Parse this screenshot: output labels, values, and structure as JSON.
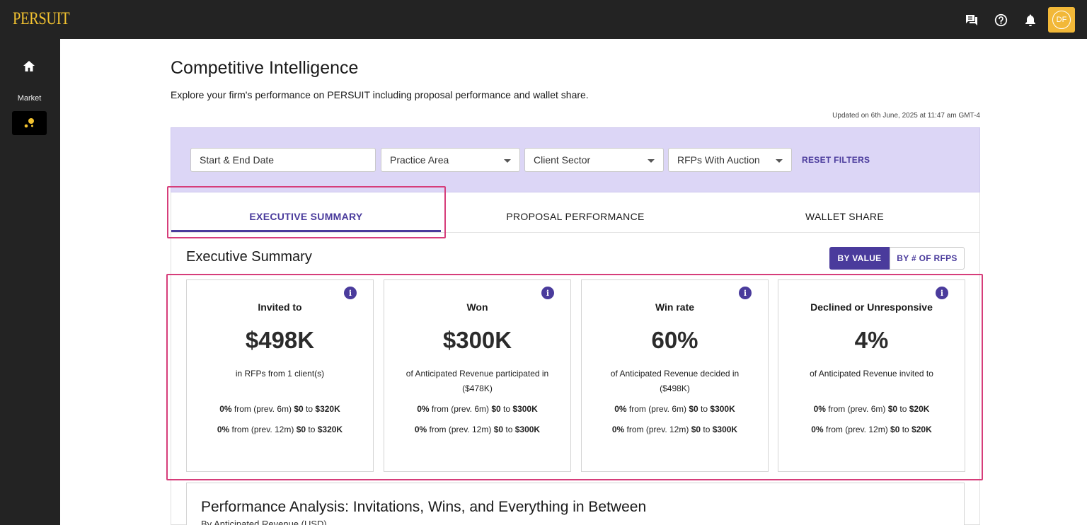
{
  "app": {
    "logo": "PERSUIT",
    "avatar_initials": "DF"
  },
  "topbar": {
    "icons": [
      "chat-icon",
      "help-icon",
      "bell-icon"
    ]
  },
  "sidebar": {
    "items": [
      {
        "icon": "home-icon",
        "label": ""
      },
      {
        "icon": "market-icon",
        "label": "Market"
      }
    ]
  },
  "page": {
    "title": "Competitive Intelligence",
    "description": "Explore your firm's performance on PERSUIT including proposal performance and wallet share.",
    "updated": "Updated on 6th June, 2025 at 11:47 am GMT-4"
  },
  "filters": {
    "date_placeholder": "Start & End Date",
    "practice_area": "Practice Area",
    "client_sector": "Client Sector",
    "rfps_auction": "RFPs With Auction",
    "reset_label": "RESET FILTERS"
  },
  "tabs": [
    {
      "label": "EXECUTIVE SUMMARY",
      "active": true
    },
    {
      "label": "PROPOSAL PERFORMANCE",
      "active": false
    },
    {
      "label": "WALLET SHARE",
      "active": false
    }
  ],
  "summary": {
    "title": "Executive Summary",
    "toggle": {
      "by_value": "BY VALUE",
      "by_count": "BY # OF RFPS",
      "selected": "by_value"
    },
    "cards": [
      {
        "title": "Invited to",
        "value": "$498K",
        "desc": "in RFPs from 1 client(s)",
        "stat6_pct": "0%",
        "stat6_mid": " from (prev. 6m) ",
        "stat6_from": "$0",
        "stat6_to": "$320K",
        "stat12_pct": "0%",
        "stat12_mid": " from (prev. 12m) ",
        "stat12_from": "$0",
        "stat12_to": "$320K"
      },
      {
        "title": "Won",
        "value": "$300K",
        "desc": "of Anticipated Revenue participated in ($478K)",
        "stat6_pct": "0%",
        "stat6_mid": " from (prev. 6m) ",
        "stat6_from": "$0",
        "stat6_to": "$300K",
        "stat12_pct": "0%",
        "stat12_mid": " from (prev. 12m) ",
        "stat12_from": "$0",
        "stat12_to": "$300K"
      },
      {
        "title": "Win rate",
        "value": "60%",
        "desc": "of Anticipated Revenue decided in ($498K)",
        "stat6_pct": "0%",
        "stat6_mid": " from (prev. 6m) ",
        "stat6_from": "$0",
        "stat6_to": "$300K",
        "stat12_pct": "0%",
        "stat12_mid": " from (prev. 12m) ",
        "stat12_from": "$0",
        "stat12_to": "$300K"
      },
      {
        "title": "Declined or Unresponsive",
        "value": "4%",
        "desc": "of Anticipated Revenue invited to",
        "stat6_pct": "0%",
        "stat6_mid": " from (prev. 6m) ",
        "stat6_from": "$0",
        "stat6_to": "$20K",
        "stat12_pct": "0%",
        "stat12_mid": " from (prev. 12m) ",
        "stat12_from": "$0",
        "stat12_to": "$20K"
      }
    ],
    "to_word": " to "
  },
  "performance": {
    "title": "Performance Analysis: Invitations, Wins, and Everything in Between",
    "subtitle": "By Anticipated Revenue (USD)"
  },
  "colors": {
    "accent": "#4a3b9c",
    "brand": "#f2c230",
    "highlight": "#d63d7a",
    "filter_bg": "#dcd6f6"
  }
}
